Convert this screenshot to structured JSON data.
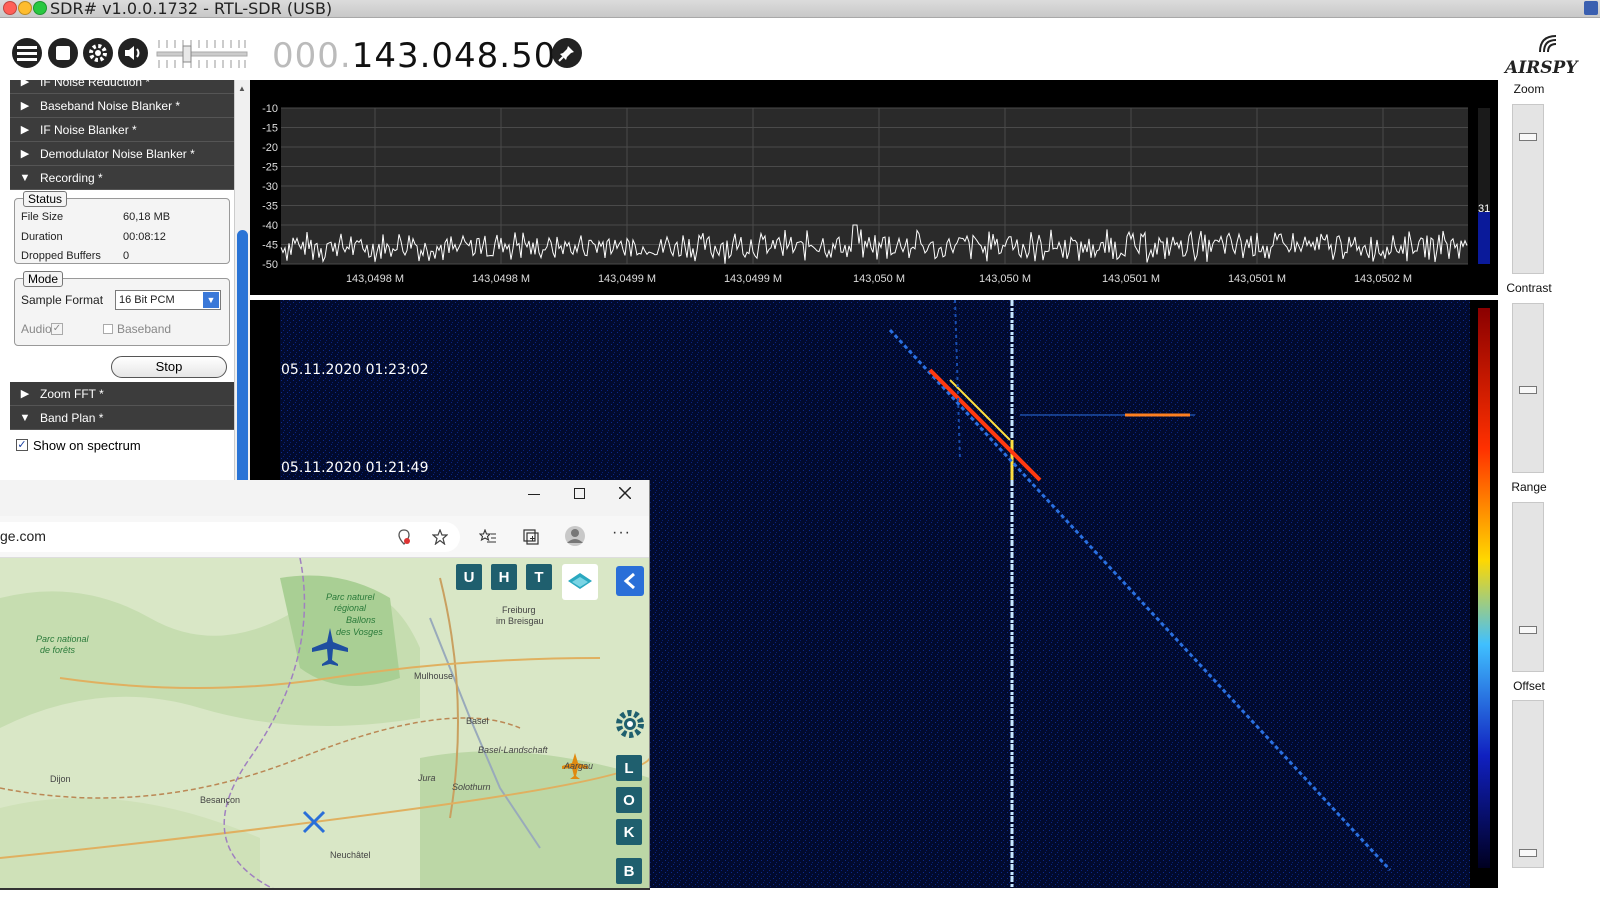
{
  "window": {
    "title": "SDR# v1.0.0.1732 - RTL-SDR (USB)"
  },
  "toolbar": {
    "frequency_dim": "000.",
    "frequency_main": "143.048.500",
    "logo": "AIRSPY"
  },
  "left_panel": {
    "sections_top": [
      {
        "label": "IF Noise Reduction *",
        "expanded": false
      },
      {
        "label": "Baseband Noise Blanker *",
        "expanded": false
      },
      {
        "label": "IF Noise Blanker *",
        "expanded": false
      },
      {
        "label": "Demodulator Noise Blanker *",
        "expanded": false
      },
      {
        "label": "Recording *",
        "expanded": true
      }
    ],
    "status": {
      "legend": "Status",
      "file_size_label": "File Size",
      "file_size_value": "60,18 MB",
      "duration_label": "Duration",
      "duration_value": "00:08:12",
      "dropped_label": "Dropped Buffers",
      "dropped_value": "0"
    },
    "mode": {
      "legend": "Mode",
      "sample_format_label": "Sample Format",
      "sample_format_value": "16 Bit PCM",
      "audio_label": "Audio",
      "audio_checked": true,
      "baseband_label": "Baseband",
      "baseband_checked": false
    },
    "stop_button": "Stop",
    "sections_bottom": [
      {
        "label": "Zoom FFT *",
        "expanded": false
      },
      {
        "label": "Band Plan *",
        "expanded": true
      }
    ],
    "show_on_spectrum_label": "Show on spectrum",
    "show_on_spectrum_checked": true
  },
  "spectrum": {
    "y_ticks": [
      "-10",
      "-15",
      "-20",
      "-25",
      "-30",
      "-35",
      "-40",
      "-45",
      "-50"
    ],
    "x_ticks": [
      "143,0498 M",
      "143,0498 M",
      "143,0499 M",
      "143,0499 M",
      "143,050 M",
      "143,050 M",
      "143,0501 M",
      "143,0501 M",
      "143,0502 M"
    ],
    "level_value": "31",
    "colors": {
      "trace": "#ffffff",
      "grid": "#4a4a4a",
      "level": "#0a1a9a"
    }
  },
  "waterfall": {
    "timestamps": [
      "05.11.2020 01:23:02",
      "05.11.2020 01:21:49"
    ],
    "colors": {
      "background": "#010a2e",
      "signal_hot": "#ff3a10",
      "signal_warm": "#ffe040"
    }
  },
  "right_panel": {
    "zoom_label": "Zoom",
    "contrast_label": "Contrast",
    "range_label": "Range",
    "offset_label": "Offset",
    "zoom_level": 0.82,
    "contrast_level": 0.48,
    "range_level": 0.22,
    "offset_level": 0.05
  },
  "browser": {
    "url": "ge.com",
    "map_buttons_top": [
      "U",
      "H",
      "T"
    ],
    "map_buttons_side": [
      "L",
      "O",
      "K",
      "B"
    ],
    "map_labels": [
      "Parc naturel",
      "régional",
      "Ballons",
      "des Vosges",
      "Freiburg",
      "im Breisgau",
      "Mulhouse",
      "Basel",
      "Basel-Landschaft",
      "Dijon",
      "Besançon",
      "Jura",
      "Solothurn",
      "Aargau",
      "Neuchâtel",
      "Parc national",
      "de forêts"
    ]
  }
}
